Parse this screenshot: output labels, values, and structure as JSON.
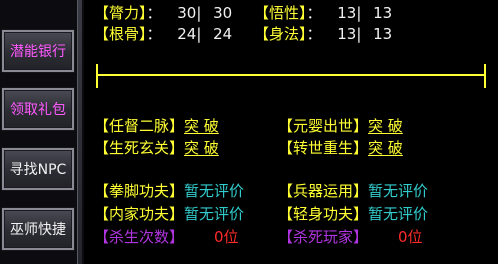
{
  "sidebar": {
    "buttons": [
      {
        "label": "潜能银行"
      },
      {
        "label": "领取礼包"
      },
      {
        "label": "寻找NPC"
      },
      {
        "label": "巫师快捷"
      }
    ]
  },
  "attributes": {
    "row1": [
      {
        "label": "【膂力】",
        "cur": "30",
        "max": "30"
      },
      {
        "label": "【悟性】",
        "cur": "13",
        "max": "13"
      }
    ],
    "row2": [
      {
        "label": "【根骨】",
        "cur": "24",
        "max": "24"
      },
      {
        "label": "【身法】",
        "cur": "13",
        "max": "13"
      }
    ]
  },
  "breakthroughs": [
    {
      "label": "【任督二脉】",
      "action": "突 破"
    },
    {
      "label": "【元婴出世】",
      "action": "突 破"
    },
    {
      "label": "【生死玄关】",
      "action": "突 破"
    },
    {
      "label": "【转世重生】",
      "action": "突 破"
    }
  ],
  "ratings": [
    {
      "label": "【拳脚功夫】",
      "value": "暂无评价"
    },
    {
      "label": "【兵器运用】",
      "value": "暂无评价"
    },
    {
      "label": "【内家功夫】",
      "value": "暂无评价"
    },
    {
      "label": "【轻身功夫】",
      "value": "暂无评价"
    }
  ],
  "rankings": [
    {
      "label": "【杀生次数】",
      "value": "0位"
    },
    {
      "label": "【杀死玩家】",
      "value": "0位"
    }
  ],
  "colors": {
    "yellow": "#ffff33",
    "cyan": "#33cccc",
    "purple": "#b035e0",
    "red": "#ff2a2a",
    "magenta": "#ff5aff"
  }
}
